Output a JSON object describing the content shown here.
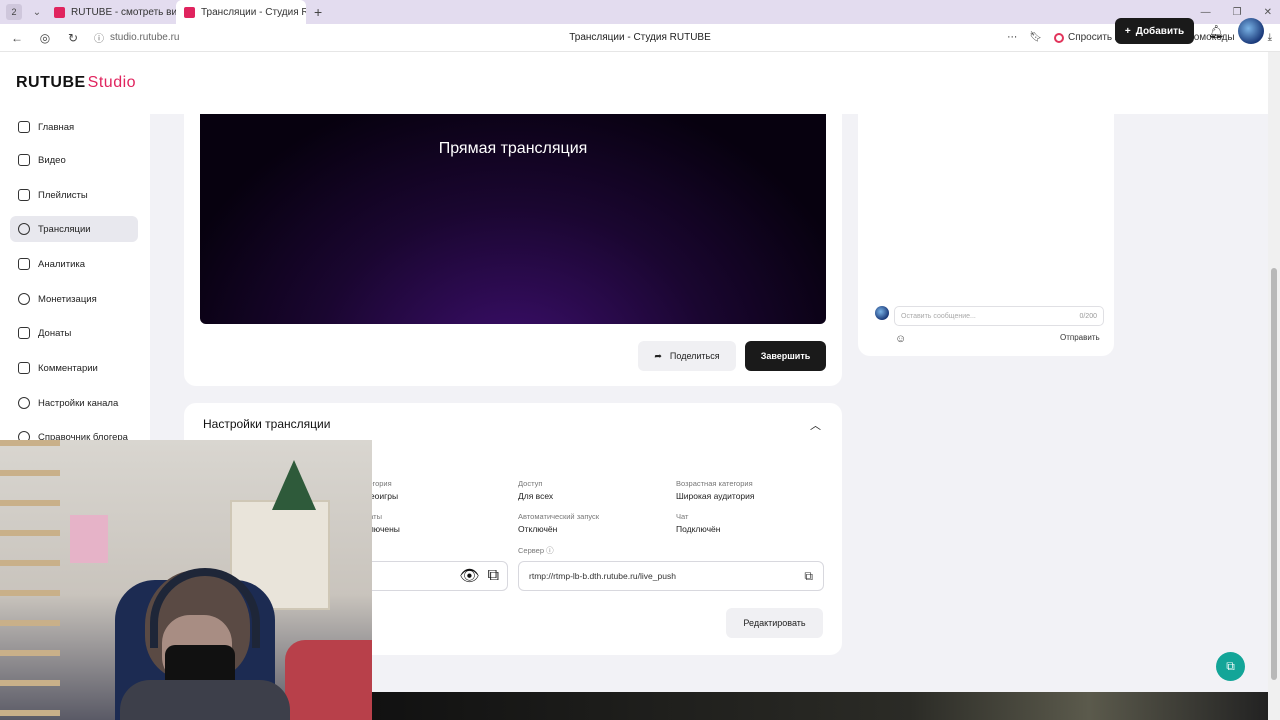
{
  "browser": {
    "tab_count": "2",
    "tabs": [
      {
        "label": "RUTUBE - смотреть виде"
      },
      {
        "label": "Трансляции - Студия R"
      }
    ],
    "url": "studio.rutube.ru",
    "page_title": "Трансляции - Студия RUTUBE",
    "alice_label": "Спросить Алису AI",
    "promo_label": "Промокоды"
  },
  "header": {
    "logo_main": "RUTUBE",
    "logo_studio": "Studio",
    "add_label": "Добавить"
  },
  "sidebar": {
    "items": [
      {
        "label": "Главная"
      },
      {
        "label": "Видео"
      },
      {
        "label": "Плейлисты"
      },
      {
        "label": "Трансляции"
      },
      {
        "label": "Аналитика"
      },
      {
        "label": "Монетизация"
      },
      {
        "label": "Донаты"
      },
      {
        "label": "Комментарии"
      },
      {
        "label": "Настройки канала"
      },
      {
        "label": "Справочник блогера"
      }
    ],
    "active_index": 3
  },
  "player": {
    "title": "Прямая трансляция",
    "share_label": "Поделиться",
    "finish_label": "Завершить"
  },
  "chat": {
    "placeholder": "Оставить сообщение...",
    "counter": "0/200",
    "send_label": "Отправить"
  },
  "settings": {
    "title": "Настройки трансляции",
    "fields": {
      "category_label": "тегория",
      "category_value": "деоигры",
      "access_label": "Доступ",
      "access_value": "Для всех",
      "age_label": "Возрастная категория",
      "age_value": "Широкая аудитория",
      "donats_label": "наты",
      "donats_value": "ключены",
      "autostart_label": "Автоматический запуск",
      "autostart_value": "Отключён",
      "chat_label": "Чат",
      "chat_value": "Подключён",
      "server_label": "Сервер",
      "server_value": "rtmp://rtmp-lb-b.dth.rutube.ru/live_push",
      "key_masked": "••••••••••••••••••••••"
    },
    "edit_label": "Редактировать"
  }
}
